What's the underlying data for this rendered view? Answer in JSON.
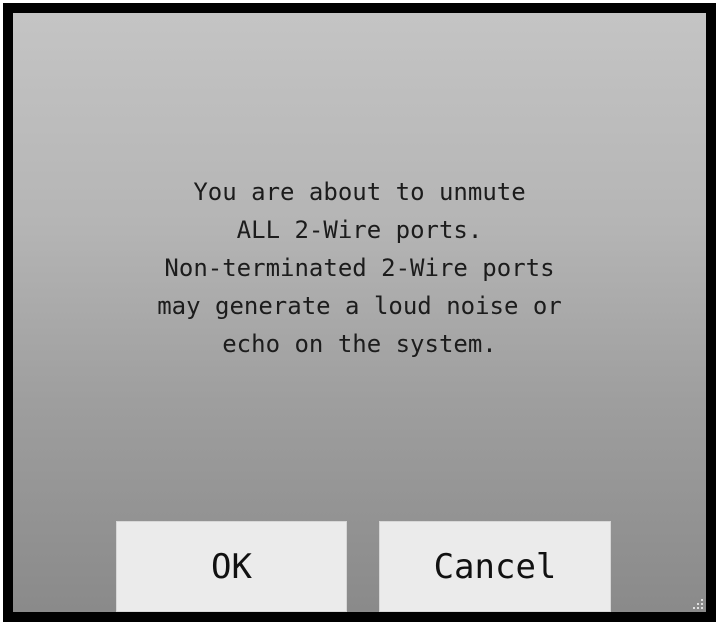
{
  "dialog": {
    "message_lines": [
      "You are about to unmute",
      "ALL 2-Wire ports.",
      "Non-terminated 2-Wire ports",
      "may generate a loud noise or",
      "echo on the system."
    ],
    "ok_label": "OK",
    "cancel_label": "Cancel"
  },
  "colors": {
    "frame": "#000000",
    "background_top": "#c4c4c4",
    "background_bottom": "#8a8a8a",
    "button_face": "#ebebeb",
    "text": "#1c1c1c"
  },
  "icons": {
    "resize_grip": "resize-grip-icon"
  }
}
